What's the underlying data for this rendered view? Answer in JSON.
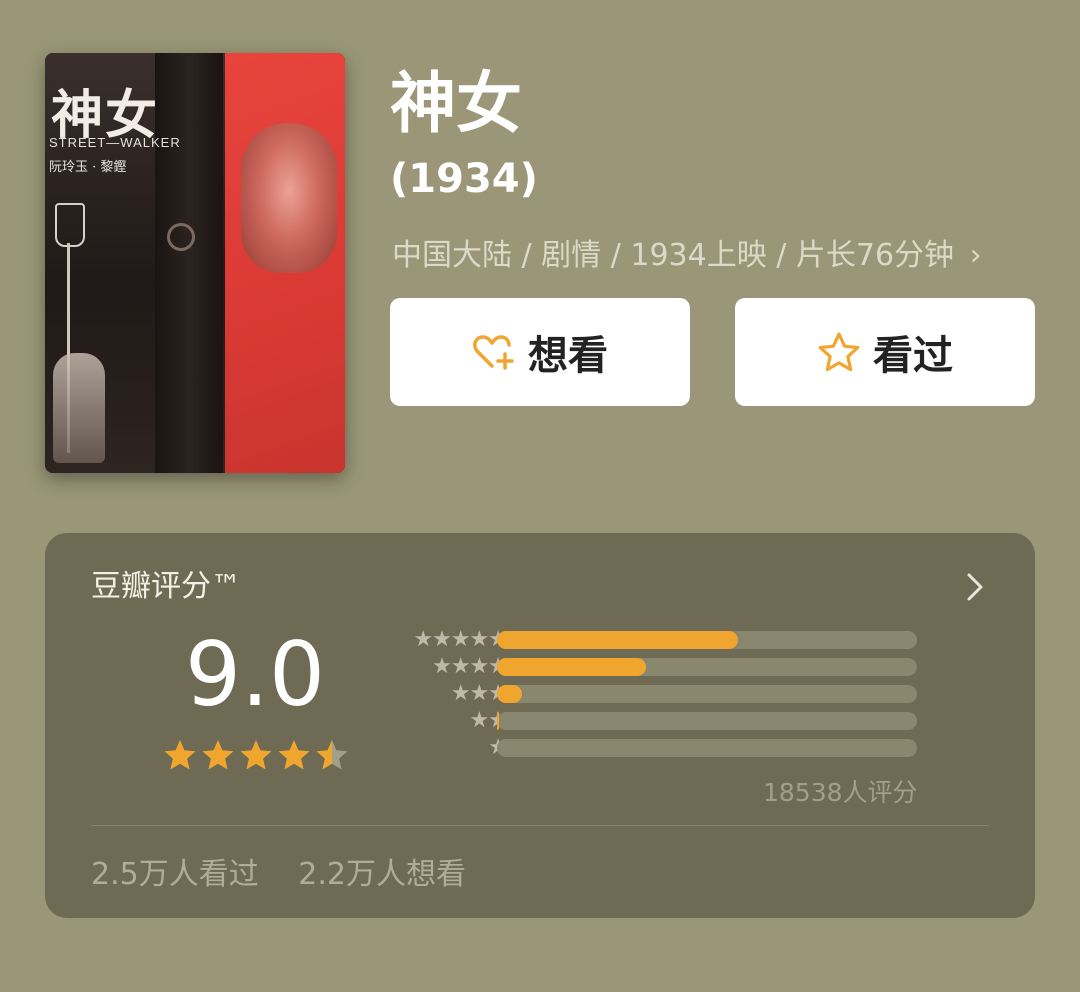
{
  "movie": {
    "title": "神女",
    "year": "(1934)",
    "meta": "中国大陆 / 剧情 / 1934上映 / 片长76分钟",
    "meta_chevron": "›",
    "poster": {
      "title_text": "神女",
      "subtitle_text": "STREET—WALKER",
      "names_text": "阮玲玉 · 黎鏗"
    }
  },
  "actions": {
    "want_label": "想看",
    "seen_label": "看过",
    "want_icon": "heart-plus-icon",
    "seen_icon": "star-outline-icon"
  },
  "rating": {
    "label": "豆瓣评分™",
    "score": "9.0",
    "stars": 4.5,
    "count_text": "18538人评分",
    "distribution": [
      {
        "stars": "★★★★★",
        "fraction": 0.575
      },
      {
        "stars": "★★★★",
        "fraction": 0.355
      },
      {
        "stars": "★★★",
        "fraction": 0.06
      },
      {
        "stars": "★★",
        "fraction": 0.005
      },
      {
        "stars": "★",
        "fraction": 0.0
      }
    ],
    "seen_stat": "2.5万人看过",
    "want_stat": "2.2万人想看"
  },
  "colors": {
    "background": "#9a9677",
    "card": "#6e6a54",
    "accent": "#f0a62e",
    "button": "#ffffff"
  }
}
